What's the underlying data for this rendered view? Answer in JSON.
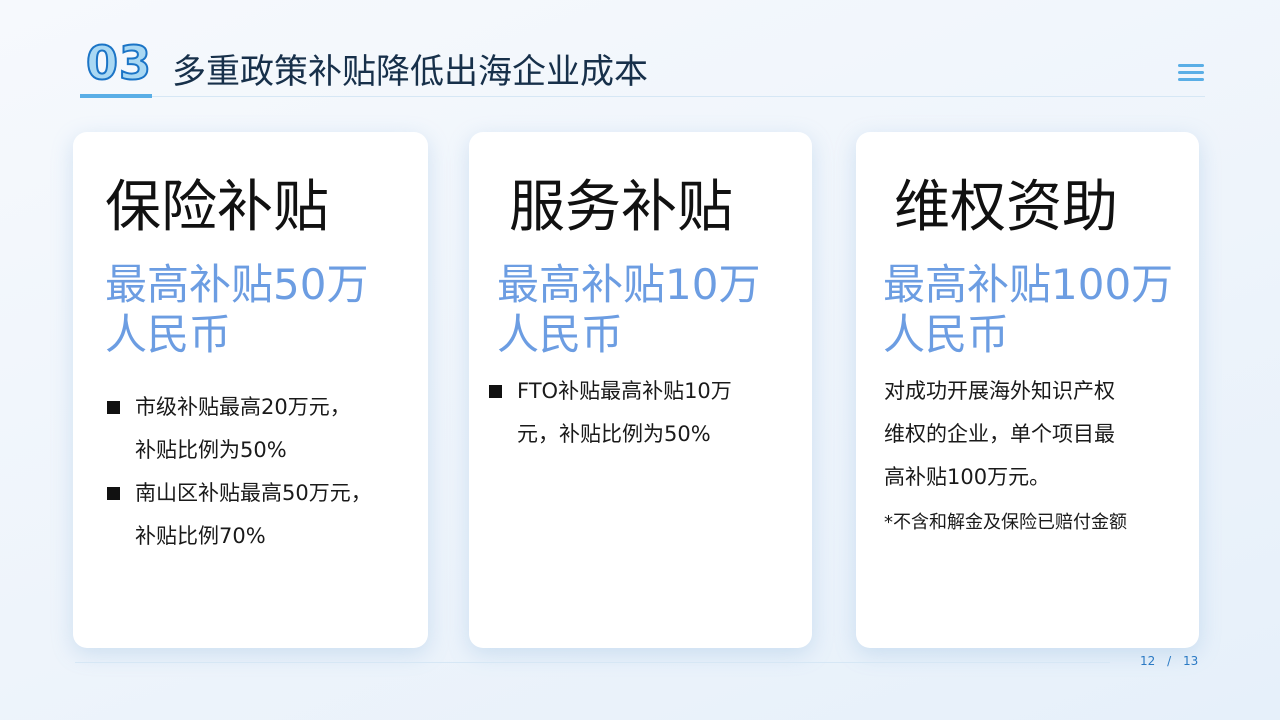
{
  "header": {
    "section_number": "03",
    "title": "多重政策补贴降低出海企业成本"
  },
  "menu": {
    "icon": "menu-icon"
  },
  "cards": [
    {
      "title": "保险补贴",
      "amount_line1": "最高补贴50万",
      "amount_line2": "人民币",
      "bullets": [
        {
          "line1": "市级补贴最高20万元，",
          "line2": "补贴比例为50%"
        },
        {
          "line1": "南山区补贴最高50万元，",
          "line2": "补贴比例70%"
        }
      ]
    },
    {
      "title": "服务补贴",
      "amount_line1": "最高补贴10万",
      "amount_line2": "人民币",
      "bullets": [
        {
          "line1": "FTO补贴最高补贴10万",
          "line2": "元，补贴比例为50%"
        }
      ]
    },
    {
      "title": "维权资助",
      "amount_line1": "最高补贴100万",
      "amount_line2": "人民币",
      "paragraph": {
        "line1": "对成功开展海外知识产权",
        "line2": "维权的企业，单个项目最",
        "line3": "高补贴100万元。"
      },
      "note": "*不含和解金及保险已赔付金额"
    }
  ],
  "footer": {
    "current_page": "12",
    "separator": "/",
    "total_pages": "13"
  },
  "colors": {
    "accent_blue": "#5aaee6",
    "amount_blue": "#6c9de2",
    "title_dark": "#17304a"
  }
}
